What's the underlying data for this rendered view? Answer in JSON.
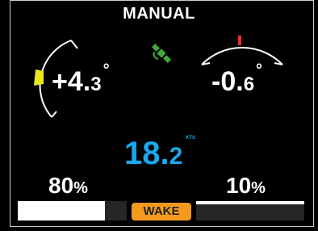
{
  "header": {
    "title": "MANUAL"
  },
  "roll": {
    "sign_int": "+4.",
    "decimal": "3",
    "degree": "°"
  },
  "pitch": {
    "sign_int": "-0.",
    "decimal": "6",
    "degree": "°"
  },
  "speed": {
    "int": "18.",
    "decimal": "2",
    "unit": "KTS"
  },
  "left_ballast": {
    "number": "80",
    "symbol": "%",
    "fill": 0.8
  },
  "right_ballast": {
    "number": "10",
    "symbol": "%",
    "fill": 0.1
  },
  "wake_button": {
    "label": "WAKE"
  },
  "colors": {
    "speed": "#19a9ee",
    "wake": "#f39a1e",
    "roll_marker": "#e8e81a",
    "pitch_marker": "#ff2a2a",
    "satellite": "#3fa83a"
  },
  "icons": {
    "gps": "satellite-icon"
  }
}
